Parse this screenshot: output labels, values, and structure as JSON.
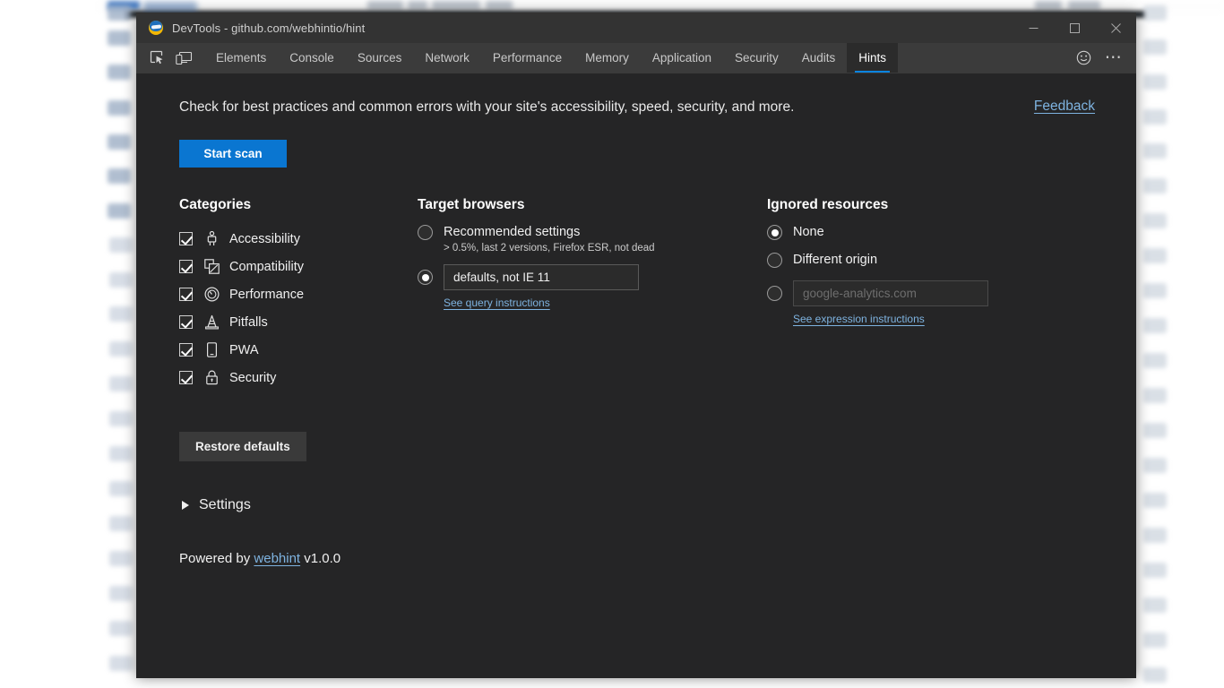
{
  "window": {
    "title": "DevTools - github.com/webhintio/hint",
    "logo_icon": "edge-logo-icon",
    "controls": {
      "minimize": "minimize-icon",
      "maximize": "maximize-icon",
      "close": "close-icon"
    }
  },
  "toolbar": {
    "inspect_icon": "inspect-element-icon",
    "device_icon": "device-toolbar-icon",
    "tabs": [
      {
        "label": "Elements",
        "active": false
      },
      {
        "label": "Console",
        "active": false
      },
      {
        "label": "Sources",
        "active": false
      },
      {
        "label": "Network",
        "active": false
      },
      {
        "label": "Performance",
        "active": false
      },
      {
        "label": "Memory",
        "active": false
      },
      {
        "label": "Application",
        "active": false
      },
      {
        "label": "Security",
        "active": false
      },
      {
        "label": "Audits",
        "active": false
      },
      {
        "label": "Hints",
        "active": true
      }
    ],
    "feedback_icon": "smiley-face-icon",
    "more_icon": "more-options-icon",
    "more_label": "⋯",
    "accent_color": "#0a84e0"
  },
  "main": {
    "intro": "Check for best practices and common errors with your site's accessibility, speed, security, and more.",
    "feedback_link": "Feedback",
    "start_scan_label": "Start scan",
    "start_scan_color": "#0a76d1",
    "restore_defaults_label": "Restore defaults",
    "settings_label": "Settings",
    "settings_expanded": false,
    "powered_prefix": "Powered by",
    "powered_link": "webhint",
    "powered_version": "v1.0.0"
  },
  "categories": {
    "title": "Categories",
    "items": [
      {
        "label": "Accessibility",
        "icon": "accessibility-person-icon",
        "checked": true
      },
      {
        "label": "Compatibility",
        "icon": "compatibility-windows-icon",
        "checked": true
      },
      {
        "label": "Performance",
        "icon": "performance-gauge-icon",
        "checked": true
      },
      {
        "label": "Pitfalls",
        "icon": "pitfalls-cone-icon",
        "checked": true
      },
      {
        "label": "PWA",
        "icon": "pwa-phone-icon",
        "checked": true
      },
      {
        "label": "Security",
        "icon": "security-lock-icon",
        "checked": true
      }
    ]
  },
  "target_browsers": {
    "title": "Target browsers",
    "recommended_label": "Recommended settings",
    "recommended_sub": "> 0.5%, last 2 versions, Firefox ESR, not dead",
    "recommended_selected": false,
    "custom_selected": true,
    "custom_value": "defaults, not IE 11",
    "custom_placeholder": "defaults, not IE 11",
    "query_link": "See query instructions"
  },
  "ignored_resources": {
    "title": "Ignored resources",
    "options": [
      {
        "label": "None",
        "selected": true
      },
      {
        "label": "Different origin",
        "selected": false
      }
    ],
    "custom_selected": false,
    "custom_value": "",
    "custom_placeholder": "google-analytics.com",
    "expression_link": "See expression instructions"
  }
}
